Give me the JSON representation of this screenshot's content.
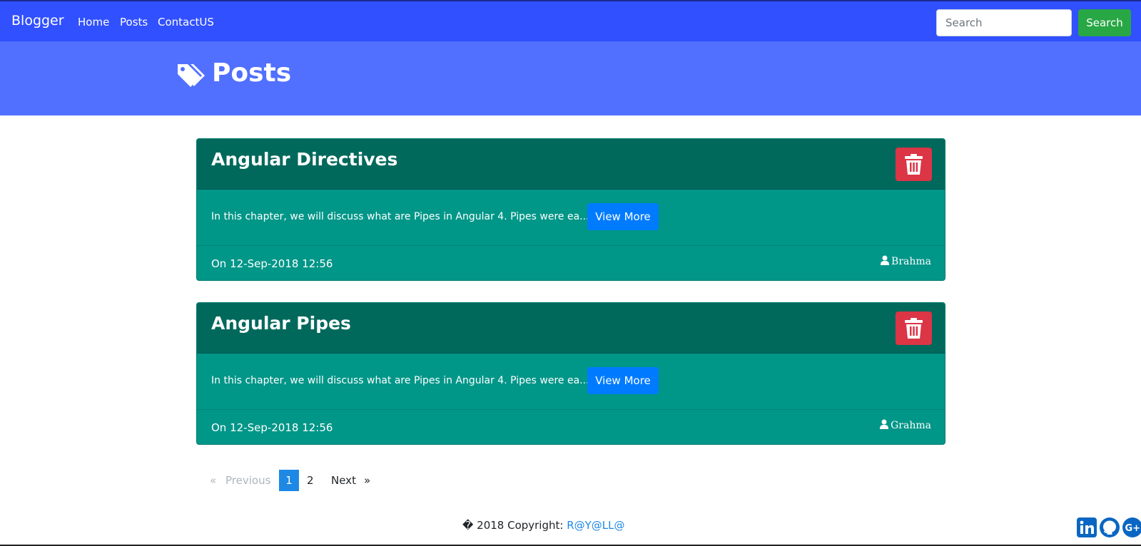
{
  "app": {
    "brand": "Blogger",
    "nav": [
      "Home",
      "Posts",
      "ContactUS"
    ],
    "search_placeholder": "Search",
    "search_button": "Search"
  },
  "header": {
    "title": "Posts",
    "icon": "tags-icon"
  },
  "posts": [
    {
      "title": "Angular Directives",
      "excerpt": "In this chapter, we will discuss what are Pipes in Angular 4. Pipes were ea...",
      "view_label": "View More",
      "date": "On 12-Sep-2018 12:56",
      "author": "Brahma"
    },
    {
      "title": "Angular Pipes",
      "excerpt": "In this chapter, we will discuss what are Pipes in Angular 4. Pipes were ea...",
      "view_label": "View More",
      "date": "On 12-Sep-2018 12:56",
      "author": "Grahma"
    }
  ],
  "pagination": {
    "prev_arrow": "«",
    "prev_label": "Previous",
    "pages": [
      "1",
      "2"
    ],
    "active_page": "1",
    "next_label": "Next",
    "next_arrow": "»"
  },
  "footer": {
    "copyright": "� 2018 Copyright: ",
    "link": "R@Y@LL@"
  },
  "social": [
    "linkedin-icon",
    "github-icon",
    "google-plus-icon"
  ],
  "colors": {
    "navbar": "#3150ff",
    "header": "#5170ff",
    "card": "#009688",
    "card_header": "#00695c",
    "delete": "#dc3545",
    "view_more": "#007bff",
    "search_button": "#28a745"
  }
}
